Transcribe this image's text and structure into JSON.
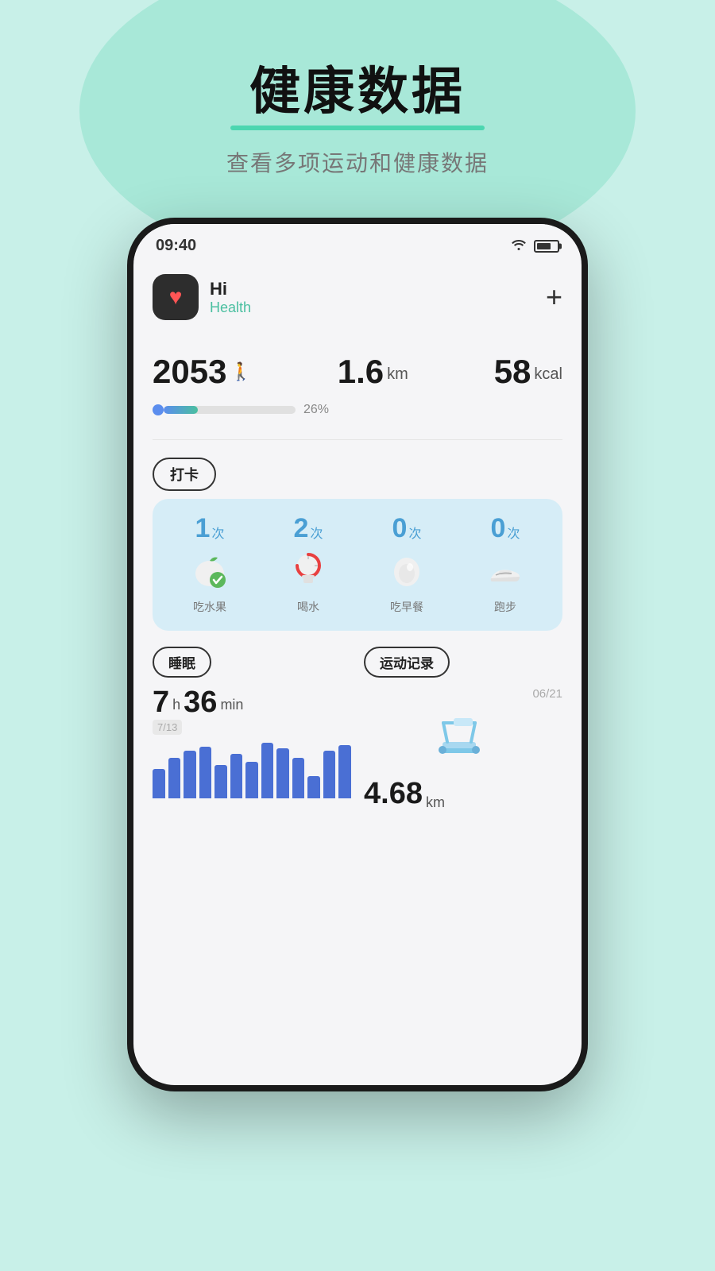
{
  "page": {
    "background_color": "#c8f0e8"
  },
  "header": {
    "main_title": "健康数据",
    "subtitle": "查看多项运动和健康数据"
  },
  "status_bar": {
    "time": "09:40",
    "wifi": "WiFi",
    "battery": "Battery"
  },
  "app_header": {
    "hi_text": "Hi",
    "health_text": "Health",
    "add_button": "+"
  },
  "stats": {
    "steps": "2053",
    "steps_unit": "🚶",
    "distance": "1.6",
    "distance_unit": "km",
    "calories": "58",
    "calories_unit": "kcal",
    "progress_percent": "26%",
    "progress_value": 26
  },
  "checkin": {
    "tag_label": "打卡",
    "items": [
      {
        "count": "1",
        "unit": "次",
        "label": "吃水果",
        "icon": "fruit"
      },
      {
        "count": "2",
        "unit": "次",
        "label": "喝水",
        "icon": "water"
      },
      {
        "count": "0",
        "unit": "次",
        "label": "吃早餐",
        "icon": "breakfast"
      },
      {
        "count": "0",
        "unit": "次",
        "label": "跑步",
        "icon": "running"
      }
    ]
  },
  "sleep": {
    "tag_label": "睡眠",
    "hours": "7",
    "hours_unit": "h",
    "minutes": "36",
    "minutes_unit": "min",
    "sub_label": "7/13",
    "chart_bars": [
      40,
      55,
      65,
      70,
      45,
      60,
      50,
      75,
      68,
      55,
      30,
      65,
      72
    ]
  },
  "exercise": {
    "tag_label": "运动记录",
    "date": "06/21",
    "distance": "4.68",
    "distance_unit": "km",
    "icon": "treadmill"
  }
}
